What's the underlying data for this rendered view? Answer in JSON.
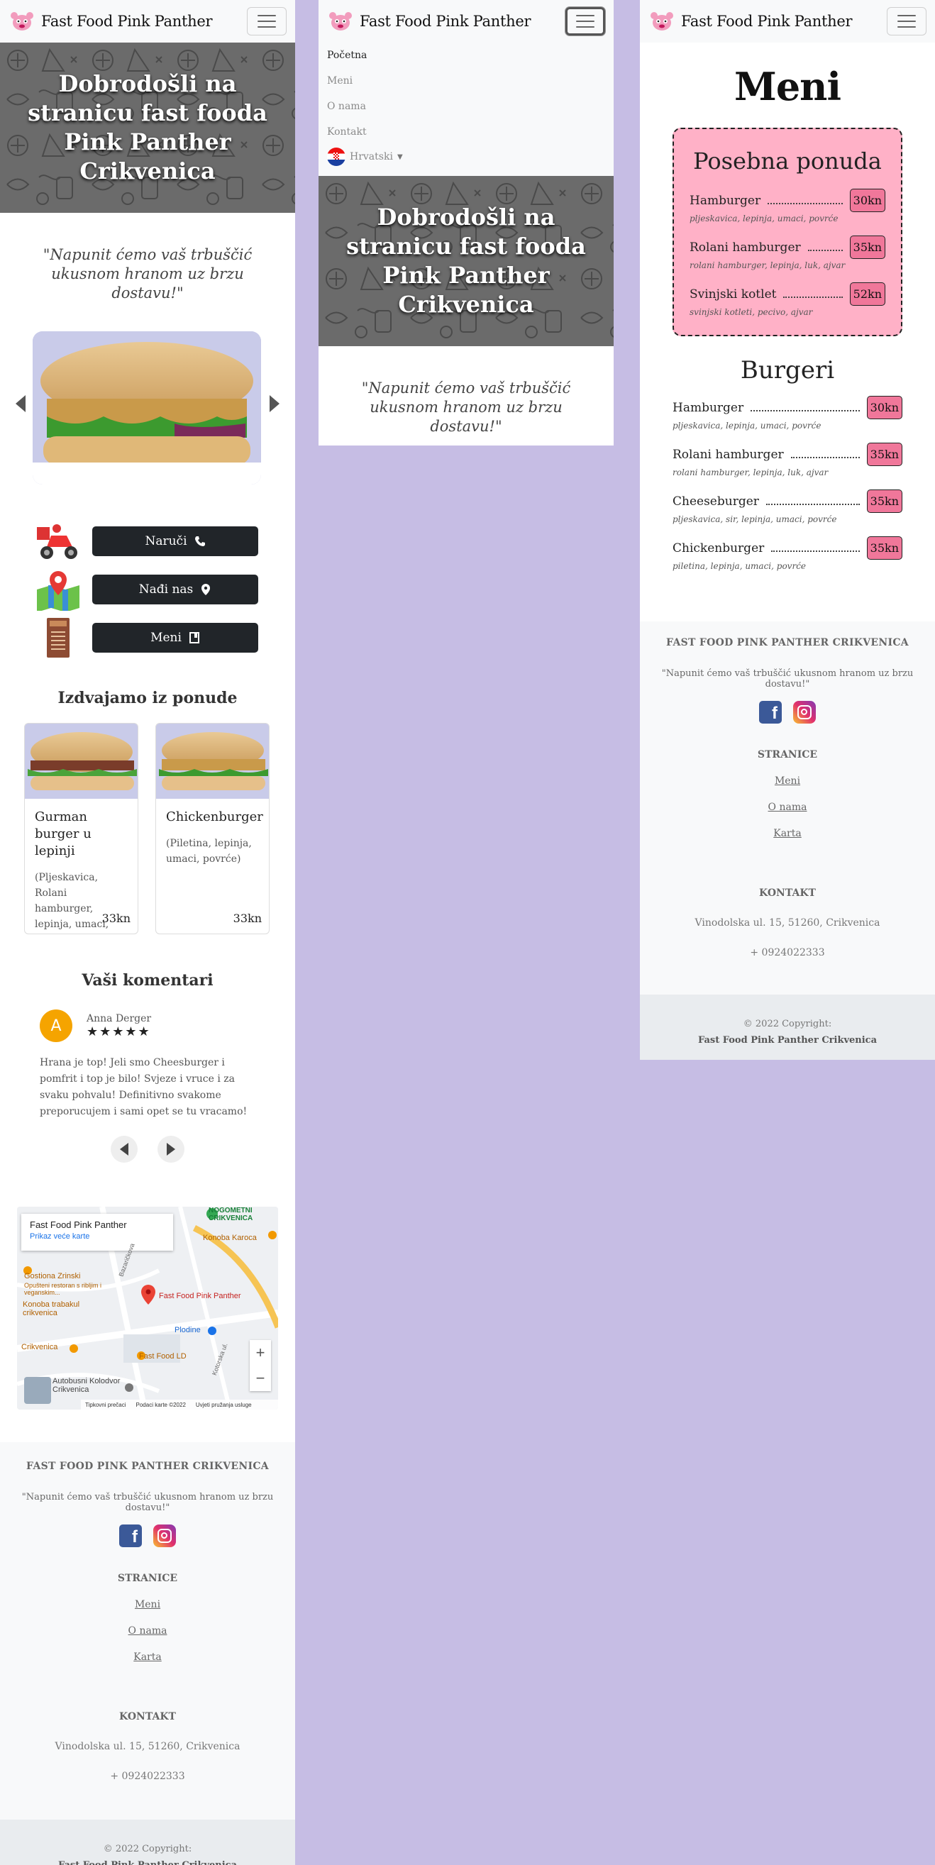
{
  "brand": "Fast Food Pink Panther",
  "nav": {
    "links": [
      "Početna",
      "Meni",
      "O nama",
      "Kontakt"
    ],
    "language": "Hrvatski"
  },
  "hero": {
    "title": "Dobrodošli na stranicu fast fooda Pink Panther Crikvenica"
  },
  "tagline": "\"Napunit ćemo vaš trbuščić ukusnom hranom uz brzu dostavu!\"",
  "actions": {
    "order": "Naruči",
    "find": "Nađi nas",
    "menu": "Meni"
  },
  "featured": {
    "title": "Izdvajamo iz ponude",
    "items": [
      {
        "name": "Gurman burger u lepinji",
        "desc": "(Pljeskavica, Rolani hamburger, lepinja, umaci, povrće)",
        "price": "33kn"
      },
      {
        "name": "Chickenburger",
        "desc": "(Piletina, lepinja, umaci, povrće)",
        "price": "33kn"
      }
    ]
  },
  "comments": {
    "title": "Vaši komentari",
    "author": "Anna Derger",
    "initial": "A",
    "rating": 5,
    "stars": "★★★★★",
    "text": "Hrana je top! Jeli smo Cheesburger i pomfrit i top je bilo! Svjeze i vruce i za svaku pohvalu! Definitivno svakome preporucujem i sami opet se tu vracamo!"
  },
  "map": {
    "place": "Fast Food Pink Panther",
    "link": "Prikaz veće karte",
    "labels": [
      "NOGOMETNI CRIKVENICA",
      "Konoba Karoca",
      "Gostiona Zrinski",
      "Opušteni restoran s ribljim i veganskim...",
      "Konoba trabakul crikvenica",
      "Fast Food Pink Panther",
      "Plodine",
      "Crikvenica",
      "Fast Food LD",
      "Autobusni Kolodvor Crikvenica",
      "Bazaričkova",
      "Kotorska ul."
    ],
    "footer": [
      "Tipkovni prečaci",
      "Podaci karte ©2022",
      "Uvjeti pružanja usluge"
    ]
  },
  "footer": {
    "title": "FAST FOOD PINK PANTHER CRIKVENICA",
    "quote": "\"Napunit ćemo vaš trbuščić ukusnom hranom uz brzu dostavu!\"",
    "pages_title": "STRANICE",
    "pages": [
      "Meni",
      "O nama",
      "Karta"
    ],
    "contact_title": "KONTAKT",
    "address": "Vinodolska ul. 15, 51260, Crikvenica",
    "phone": "+ 0924022333",
    "copyright": "© 2022 Copyright:",
    "copyright_name": "Fast Food Pink Panther Crikvenica"
  },
  "menu_page": {
    "title": "Meni",
    "special_title": "Posebna ponuda",
    "special": [
      {
        "name": "Hamburger",
        "price": "30kn",
        "desc": "pljeskavica, lepinja, umaci, povrće"
      },
      {
        "name": "Rolani hamburger",
        "price": "35kn",
        "desc": "rolani hamburger, lepinja, luk, ajvar"
      },
      {
        "name": "Svinjski kotlet",
        "price": "52kn",
        "desc": "svinjski kotleti, pecivo, ajvar"
      }
    ],
    "burgers_title": "Burgeri",
    "burgers": [
      {
        "name": "Hamburger",
        "price": "30kn",
        "desc": "pljeskavica, lepinja, umaci, povrće"
      },
      {
        "name": "Rolani hamburger",
        "price": "35kn",
        "desc": "rolani hamburger, lepinja, luk, ajvar"
      },
      {
        "name": "Cheeseburger",
        "price": "35kn",
        "desc": "pljeskavica, sir, lepinja, umaci, povrće"
      },
      {
        "name": "Chickenburger",
        "price": "35kn",
        "desc": "piletina, lepinja, umaci, povrće"
      }
    ]
  },
  "colors": {
    "page_bg": "#c6bde4",
    "special_bg": "#ffb1c7",
    "price_bg": "#f0779a",
    "button_dark": "#212529"
  }
}
